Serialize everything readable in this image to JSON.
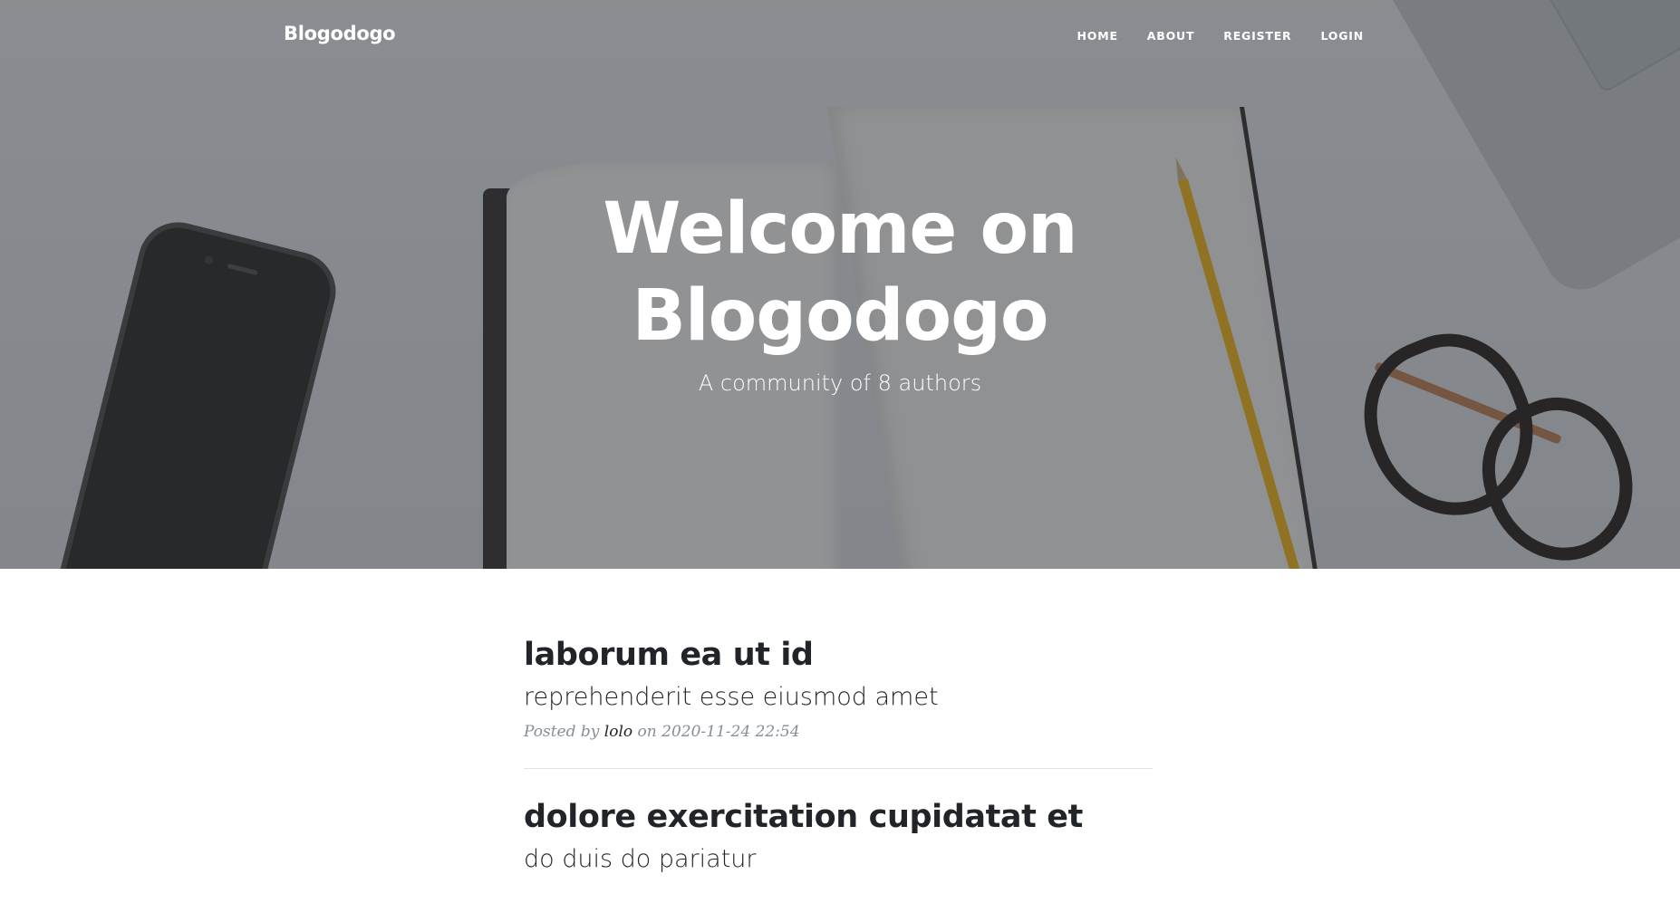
{
  "navbar": {
    "brand": "Blogodogo",
    "links": [
      {
        "label": "HOME"
      },
      {
        "label": "ABOUT"
      },
      {
        "label": "REGISTER"
      },
      {
        "label": "LOGIN"
      }
    ]
  },
  "hero": {
    "title": "Welcome on Blogodogo",
    "subheading": "A community of 8 authors"
  },
  "posts": [
    {
      "title": "laborum ea ut id",
      "subtitle": "reprehenderit esse eiusmod amet",
      "meta_prefix": "Posted by",
      "author": "lolo",
      "meta_on": "on",
      "date": "2020-11-24 22:54"
    },
    {
      "title": "dolore exercitation cupidatat et",
      "subtitle": "do duis do pariatur"
    }
  ]
}
